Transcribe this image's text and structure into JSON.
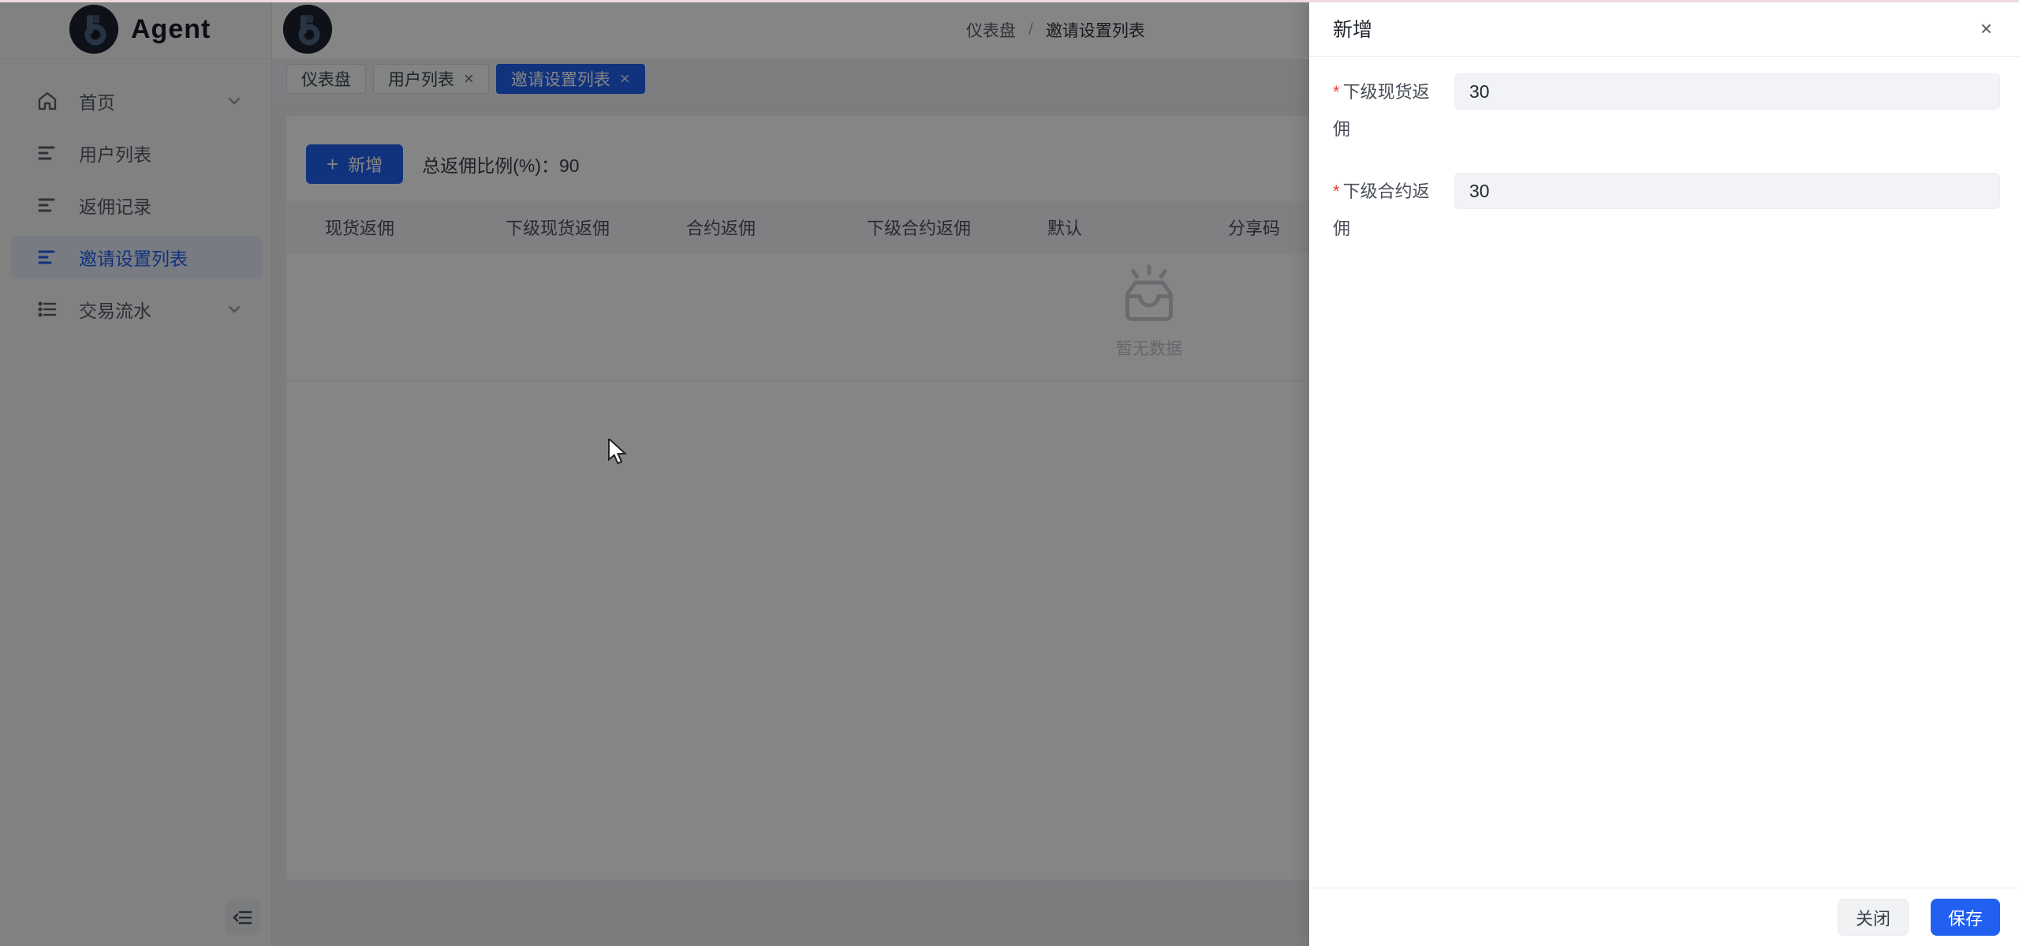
{
  "app": {
    "title": "Agent"
  },
  "colors": {
    "primary": "#2160f0",
    "sidebar_active_text": "#2160f0",
    "required": "#f23c3c"
  },
  "sidebar": {
    "items": [
      {
        "label": "首页",
        "icon": "home-icon",
        "chevron": true,
        "active": false
      },
      {
        "label": "用户列表",
        "icon": "list-icon",
        "chevron": false,
        "active": false
      },
      {
        "label": "返佣记录",
        "icon": "list-icon",
        "chevron": false,
        "active": false
      },
      {
        "label": "邀请设置列表",
        "icon": "list-icon",
        "chevron": false,
        "active": true
      },
      {
        "label": "交易流水",
        "icon": "list-dots-icon",
        "chevron": true,
        "active": false
      }
    ]
  },
  "header": {
    "breadcrumb": {
      "first": "仪表盘",
      "separator": "/",
      "last": "邀请设置列表"
    }
  },
  "tabs": [
    {
      "label": "仪表盘",
      "closable": false,
      "active": false
    },
    {
      "label": "用户列表",
      "closable": true,
      "active": false
    },
    {
      "label": "邀请设置列表",
      "closable": true,
      "active": true
    }
  ],
  "toolbar": {
    "add_label": "新增",
    "plus": "+",
    "ratio_label": "总返佣比例(%)：",
    "ratio_value": "90"
  },
  "table": {
    "columns": [
      "现货返佣",
      "下级现货返佣",
      "合约返佣",
      "下级合约返佣",
      "默认",
      "分享码"
    ],
    "empty_text": "暂无数据"
  },
  "drawer": {
    "title": "新增",
    "close_icon": "×",
    "fields": [
      {
        "label": "下级现货返佣",
        "required": "*",
        "value": "30"
      },
      {
        "label": "下级合约返佣",
        "required": "*",
        "value": "30"
      }
    ],
    "close_label": "关闭",
    "save_label": "保存"
  },
  "tab_close_glyph": "×"
}
